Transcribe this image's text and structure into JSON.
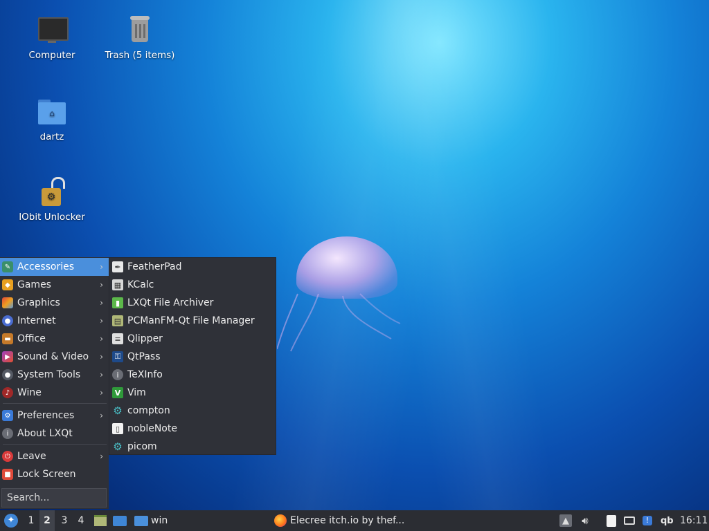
{
  "desktop": {
    "icons": [
      {
        "label": "Computer",
        "icon": "monitor-icon"
      },
      {
        "label": "Trash (5 items)",
        "icon": "trash-icon"
      },
      {
        "label": "dartz",
        "icon": "home-folder-icon"
      },
      {
        "label": "IObit Unlocker",
        "icon": "unlocker-icon"
      }
    ]
  },
  "start_menu": {
    "categories": [
      {
        "label": "Accessories",
        "icon": "accessories-icon",
        "has_submenu": true,
        "active": true
      },
      {
        "label": "Games",
        "icon": "games-icon",
        "has_submenu": true
      },
      {
        "label": "Graphics",
        "icon": "graphics-icon",
        "has_submenu": true
      },
      {
        "label": "Internet",
        "icon": "internet-icon",
        "has_submenu": true
      },
      {
        "label": "Office",
        "icon": "office-icon",
        "has_submenu": true
      },
      {
        "label": "Sound & Video",
        "icon": "sound-video-icon",
        "has_submenu": true
      },
      {
        "label": "System Tools",
        "icon": "system-tools-icon",
        "has_submenu": true
      },
      {
        "label": "Wine",
        "icon": "wine-icon",
        "has_submenu": true
      }
    ],
    "settings": [
      {
        "label": "Preferences",
        "icon": "preferences-icon",
        "has_submenu": true
      },
      {
        "label": "About LXQt",
        "icon": "info-icon",
        "has_submenu": false
      }
    ],
    "session": [
      {
        "label": "Leave",
        "icon": "power-icon",
        "has_submenu": true
      },
      {
        "label": "Lock Screen",
        "icon": "lock-icon",
        "has_submenu": false
      }
    ],
    "search_placeholder": "Search..."
  },
  "submenu": {
    "items": [
      {
        "label": "FeatherPad",
        "icon": "featherpad-icon"
      },
      {
        "label": "KCalc",
        "icon": "calculator-icon"
      },
      {
        "label": "LXQt File Archiver",
        "icon": "archive-icon"
      },
      {
        "label": "PCManFM-Qt File Manager",
        "icon": "file-manager-icon"
      },
      {
        "label": "Qlipper",
        "icon": "clipboard-icon"
      },
      {
        "label": "QtPass",
        "icon": "password-icon"
      },
      {
        "label": "TeXInfo",
        "icon": "info-icon"
      },
      {
        "label": "Vim",
        "icon": "vim-icon"
      },
      {
        "label": "compton",
        "icon": "gear-icon"
      },
      {
        "label": "nobleNote",
        "icon": "note-icon"
      },
      {
        "label": "picom",
        "icon": "gear-icon"
      }
    ]
  },
  "taskbar": {
    "workspaces": [
      "1",
      "2",
      "3",
      "4"
    ],
    "active_workspace": "2",
    "folder_label": "win",
    "window_title": "Elecree itch.io by thef...",
    "tray_qb": "qb",
    "clock": "16:11"
  },
  "colors": {
    "accent": "#4a8fdc",
    "menu_bg": "#2f3138",
    "taskbar_bg": "#2b2d33"
  }
}
